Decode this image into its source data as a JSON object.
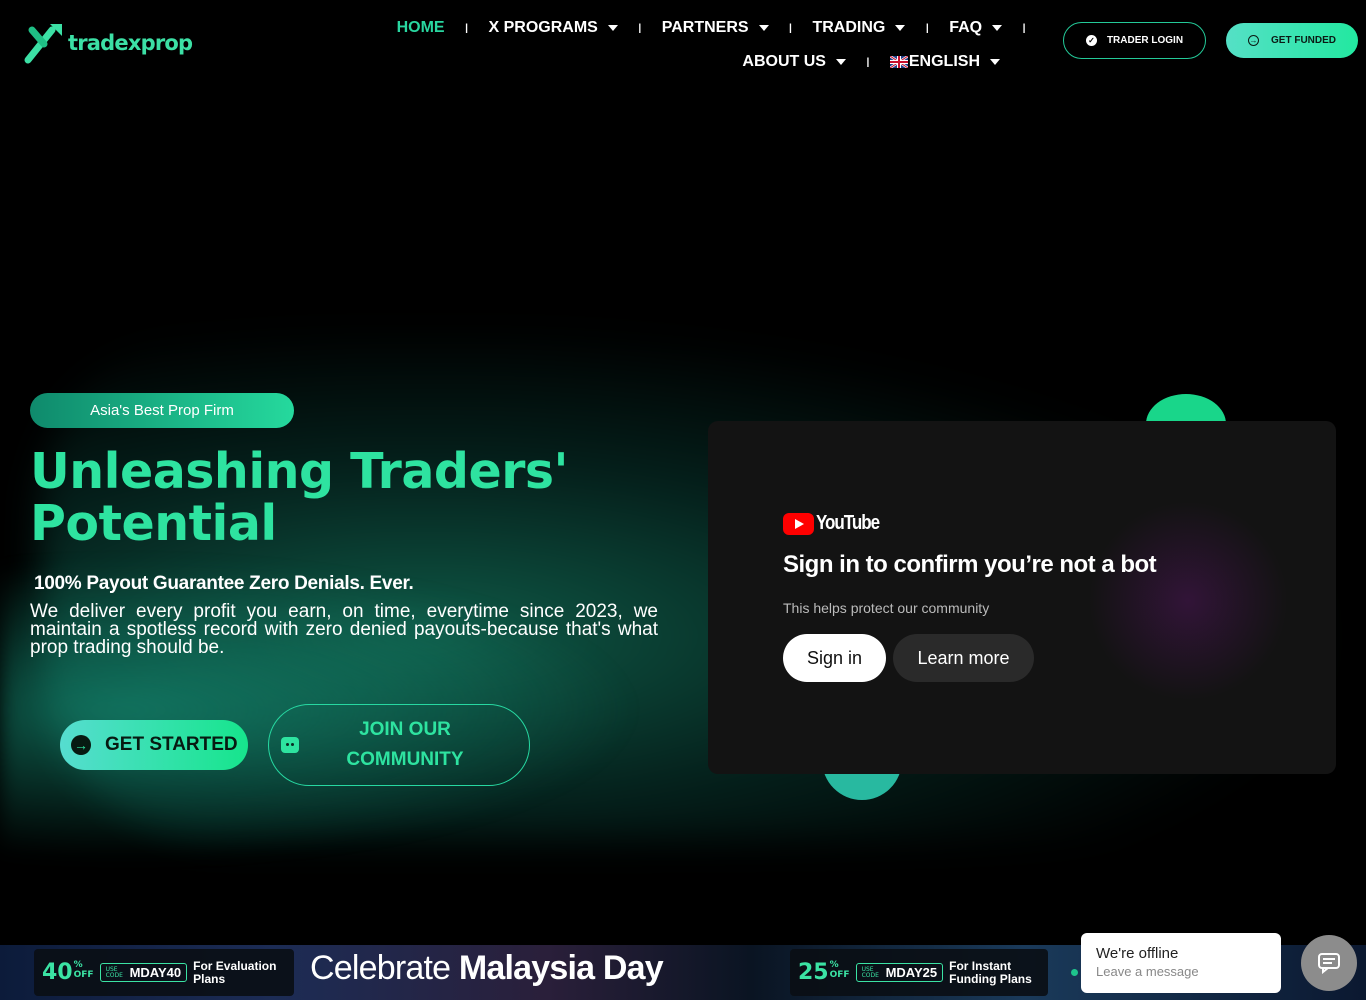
{
  "header": {
    "logo_text": "tradexprop",
    "nav": [
      {
        "label": "HOME",
        "active": true,
        "dropdown": false
      },
      {
        "label": "X PROGRAMS",
        "active": false,
        "dropdown": true
      },
      {
        "label": "PARTNERS",
        "active": false,
        "dropdown": true
      },
      {
        "label": "TRADING",
        "active": false,
        "dropdown": true
      },
      {
        "label": "FAQ",
        "active": false,
        "dropdown": true
      },
      {
        "label": "ABOUT US",
        "active": false,
        "dropdown": true
      }
    ],
    "language": "ENGLISH",
    "login_label": "TRADER LOGIN",
    "funded_label": "GET FUNDED"
  },
  "hero": {
    "badge": "Asia's Best Prop Firm",
    "headline": "Unleashing Traders' Potential",
    "subheadline": "100% Payout Guarantee Zero Denials. Ever.",
    "paragraph": "We deliver every profit you earn, on time, everytime since 2023, we maintain a spotless record with zero denied payouts-because that's what prop trading should be.",
    "cta_start": "GET STARTED",
    "cta_community": "JOIN OUR COMMUNITY"
  },
  "video": {
    "brand": "YouTube",
    "title": "Sign in to confirm you’re not a bot",
    "subtitle": "This helps protect our community",
    "signin_label": "Sign in",
    "learn_label": "Learn more"
  },
  "promo": {
    "offer1": {
      "percent": "40",
      "off": "OFF",
      "use_code": "USE CODE",
      "code": "MDAY40",
      "plan": "For Evaluation Plans"
    },
    "celebrate_prefix": "Celebrate",
    "celebrate_bold": "Malaysia Day",
    "offer2": {
      "percent": "25",
      "off": "OFF",
      "use_code": "USE CODE",
      "code": "MDAY25",
      "plan": "For Instant Funding Plans"
    }
  },
  "chat": {
    "status": "We're offline",
    "prompt": "Leave a message"
  },
  "colors": {
    "accent": "#2ee3a0",
    "background": "#000000"
  }
}
